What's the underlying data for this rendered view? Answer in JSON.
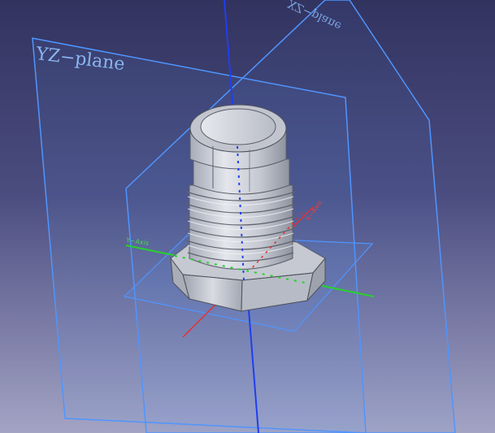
{
  "viewport": {
    "background_top": "#32335f",
    "background_bottom": "#a3a4c4"
  },
  "planes": {
    "yz_label": "YZ−plane",
    "xz_label": "XZ−plane",
    "color": "#5aa0ff"
  },
  "axes": {
    "x_label": "X−Axis",
    "y_label": "Y−Axis",
    "x_color": "#e03030",
    "y_color": "#2bd42b",
    "z_color": "#1030e0"
  },
  "model": {
    "description_icon": "threaded-hex-fitting",
    "body_color": "#c9ccd4",
    "thread_count": 6
  }
}
